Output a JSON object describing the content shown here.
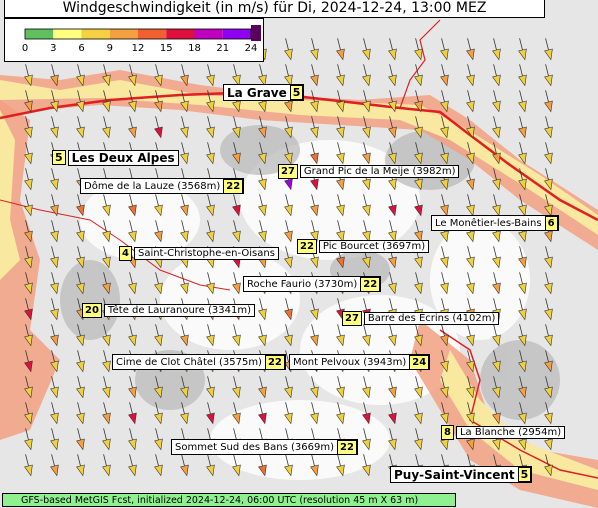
{
  "title": "Windgeschwindigkeit (in m/s) für Di, 2024-12-24, 13:00 MEZ",
  "legend": {
    "ticks": [
      "0",
      "3",
      "6",
      "9",
      "12",
      "15",
      "18",
      "21",
      "24"
    ],
    "colors": [
      "#60c060",
      "#ffff80",
      "#f5d040",
      "#f5a040",
      "#f06030",
      "#e0103c",
      "#c000c0",
      "#9000f0",
      "#5a005a"
    ]
  },
  "footer": "GFS-based MetGIS Fcst, initialized 2024-12-24, 06:00 UTC  (resolution 45 m X 63 m)",
  "places": [
    {
      "name": "La Grave",
      "value": "5"
    },
    {
      "name": "Les Deux Alpes",
      "value": "5"
    },
    {
      "name": "Dôme de la Lauze (3568m)",
      "value": "22"
    },
    {
      "name": "Grand Pic de la Meije (3982m)",
      "value": "27"
    },
    {
      "name": "Le Monêtier-les-Bains",
      "value": "6"
    },
    {
      "name": "Pic Bourcet (3697m)",
      "value": "22"
    },
    {
      "name": "Saint-Christophe-en-Oisans",
      "value": "4"
    },
    {
      "name": "Roche Faurio (3730m)",
      "value": "22"
    },
    {
      "name": "Tête de Lauranoure (3341m)",
      "value": "20"
    },
    {
      "name": "Barre des Ecrins (4102m)",
      "value": "27"
    },
    {
      "name": "Cime de Clot Châtel (3575m)",
      "value": "22"
    },
    {
      "name": "Mont Pelvoux (3943m)",
      "value": "24"
    },
    {
      "name": "La Blanche (2954m)",
      "value": "8"
    },
    {
      "name": "Sommet Sud des Bans (3669m)",
      "value": "22"
    },
    {
      "name": "Puy-Saint-Vincent",
      "value": "5"
    }
  ]
}
